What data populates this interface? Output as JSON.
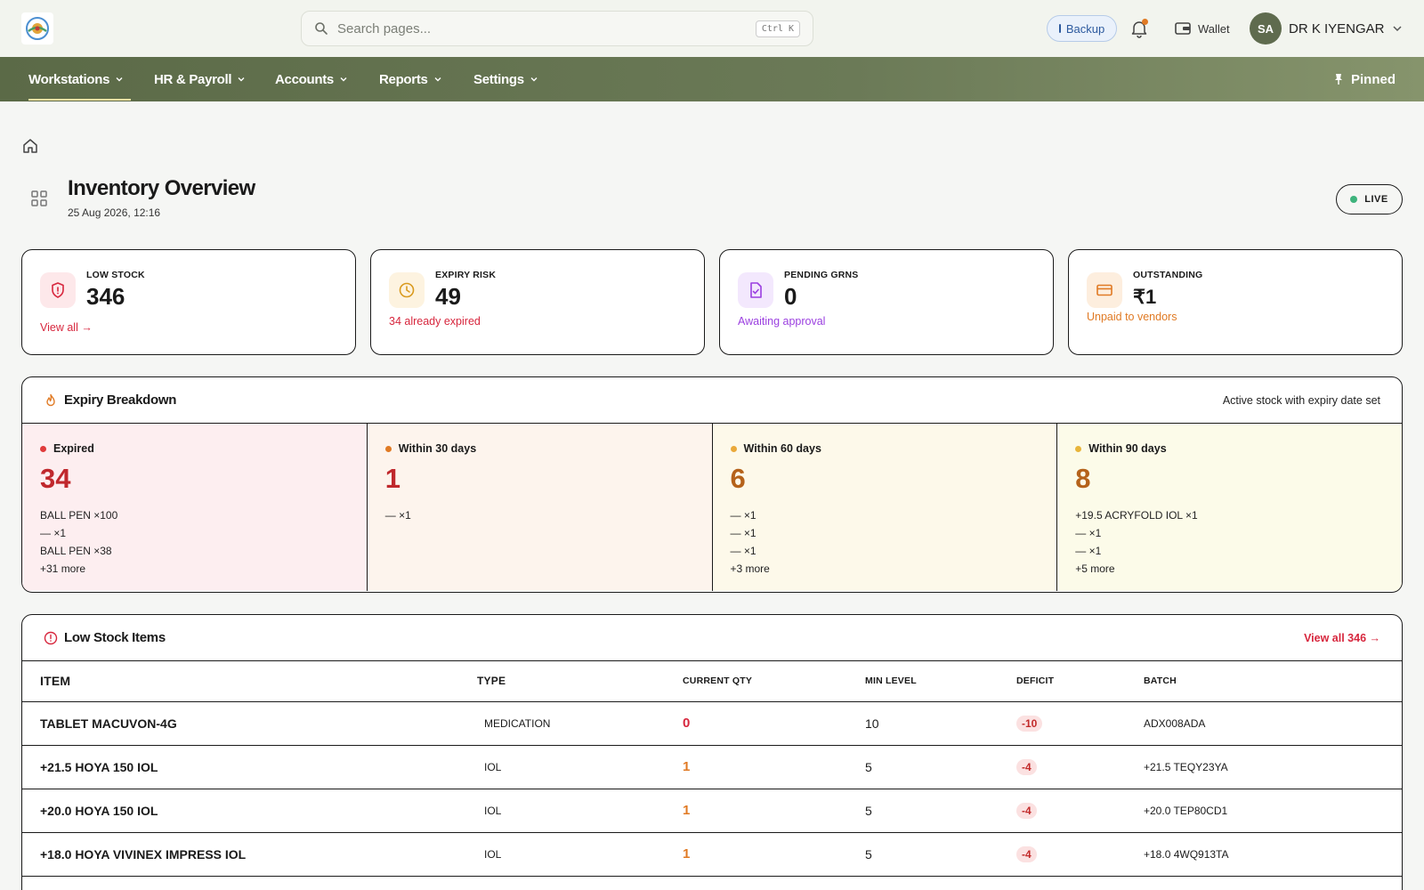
{
  "search": {
    "placeholder": "Search pages...",
    "shortcut": "Ctrl K"
  },
  "header": {
    "backup_label": "Backup",
    "wallet_label": "Wallet",
    "user_initials": "SA",
    "user_name": "DR K IYENGAR"
  },
  "nav": {
    "items": [
      {
        "label": "Workstations",
        "active": true
      },
      {
        "label": "HR & Payroll"
      },
      {
        "label": "Accounts"
      },
      {
        "label": "Reports"
      },
      {
        "label": "Settings"
      }
    ],
    "pinned_label": "Pinned"
  },
  "page": {
    "title": "Inventory Overview",
    "timestamp": "25 Aug 2026, 12:16",
    "live_label": "LIVE"
  },
  "kpis": [
    {
      "label": "LOW STOCK",
      "value": "346",
      "note": "View all →",
      "note_color": "#d7263d",
      "icon": "shield-alert-icon",
      "icon_bg": "#fde8ea",
      "icon_color": "#d7263d"
    },
    {
      "label": "EXPIRY RISK",
      "value": "49",
      "note": "34 already expired",
      "note_color": "#d7263d",
      "icon": "clock-icon",
      "icon_bg": "#fdf3e0",
      "icon_color": "#d99a1e"
    },
    {
      "label": "PENDING GRNS",
      "value": "0",
      "note": "Awaiting approval",
      "note_color": "#9b3fe0",
      "icon": "file-check-icon",
      "icon_bg": "#f3e8fd",
      "icon_color": "#9b3fe0"
    },
    {
      "label": "OUTSTANDING",
      "value": "₹1",
      "note": "Unpaid to vendors",
      "note_color": "#e07a24",
      "icon": "credit-card-icon",
      "icon_bg": "#fdeede",
      "icon_color": "#e07a24"
    }
  ],
  "expiry": {
    "title": "Expiry Breakdown",
    "subtitle": "Active stock with expiry date set",
    "buckets": [
      {
        "label": "Expired",
        "value": "34",
        "dot": "#e03b3b",
        "value_color": "#c0282d",
        "bg": "#fdeef0",
        "items": [
          "BALL PEN ×100",
          "— ×1",
          "BALL PEN ×38",
          "+31 more"
        ]
      },
      {
        "label": "Within 30 days",
        "value": "1",
        "dot": "#e07a24",
        "value_color": "#c0282d",
        "bg": "#fdf4ed",
        "items": [
          "— ×1"
        ]
      },
      {
        "label": "Within 60 days",
        "value": "6",
        "dot": "#eaa93a",
        "value_color": "#b5621a",
        "bg": "#fdf9ea",
        "items": [
          "— ×1",
          "— ×1",
          "— ×1",
          "+3 more"
        ]
      },
      {
        "label": "Within 90 days",
        "value": "8",
        "dot": "#e8b53a",
        "value_color": "#b5621a",
        "bg": "#fcfbe9",
        "items": [
          "+19.5 ACRYFOLD IOL ×1",
          "— ×1",
          "— ×1",
          "+5 more"
        ]
      }
    ]
  },
  "low_stock": {
    "title": "Low Stock Items",
    "view_all": "View all 346 →",
    "columns": [
      "ITEM",
      "TYPE",
      "CURRENT QTY",
      "MIN LEVEL",
      "DEFICIT",
      "BATCH"
    ],
    "rows": [
      {
        "item": "TABLET MACUVON-4G",
        "type": "MEDICATION",
        "current": "0",
        "current_color": "#d7263d",
        "min": "10",
        "deficit": "-10",
        "batch": "ADX008ADA"
      },
      {
        "item": "+21.5 HOYA 150 IOL",
        "type": "IOL",
        "current": "1",
        "current_color": "#e07a24",
        "min": "5",
        "deficit": "-4",
        "batch": "+21.5 TEQY23YA"
      },
      {
        "item": "+20.0 HOYA 150 IOL",
        "type": "IOL",
        "current": "1",
        "current_color": "#e07a24",
        "min": "5",
        "deficit": "-4",
        "batch": "+20.0 TEP80CD1"
      },
      {
        "item": "+18.0 HOYA VIVINEX IMPRESS IOL",
        "type": "IOL",
        "current": "1",
        "current_color": "#e07a24",
        "min": "5",
        "deficit": "-4",
        "batch": "+18.0 4WQ913TA"
      }
    ]
  }
}
